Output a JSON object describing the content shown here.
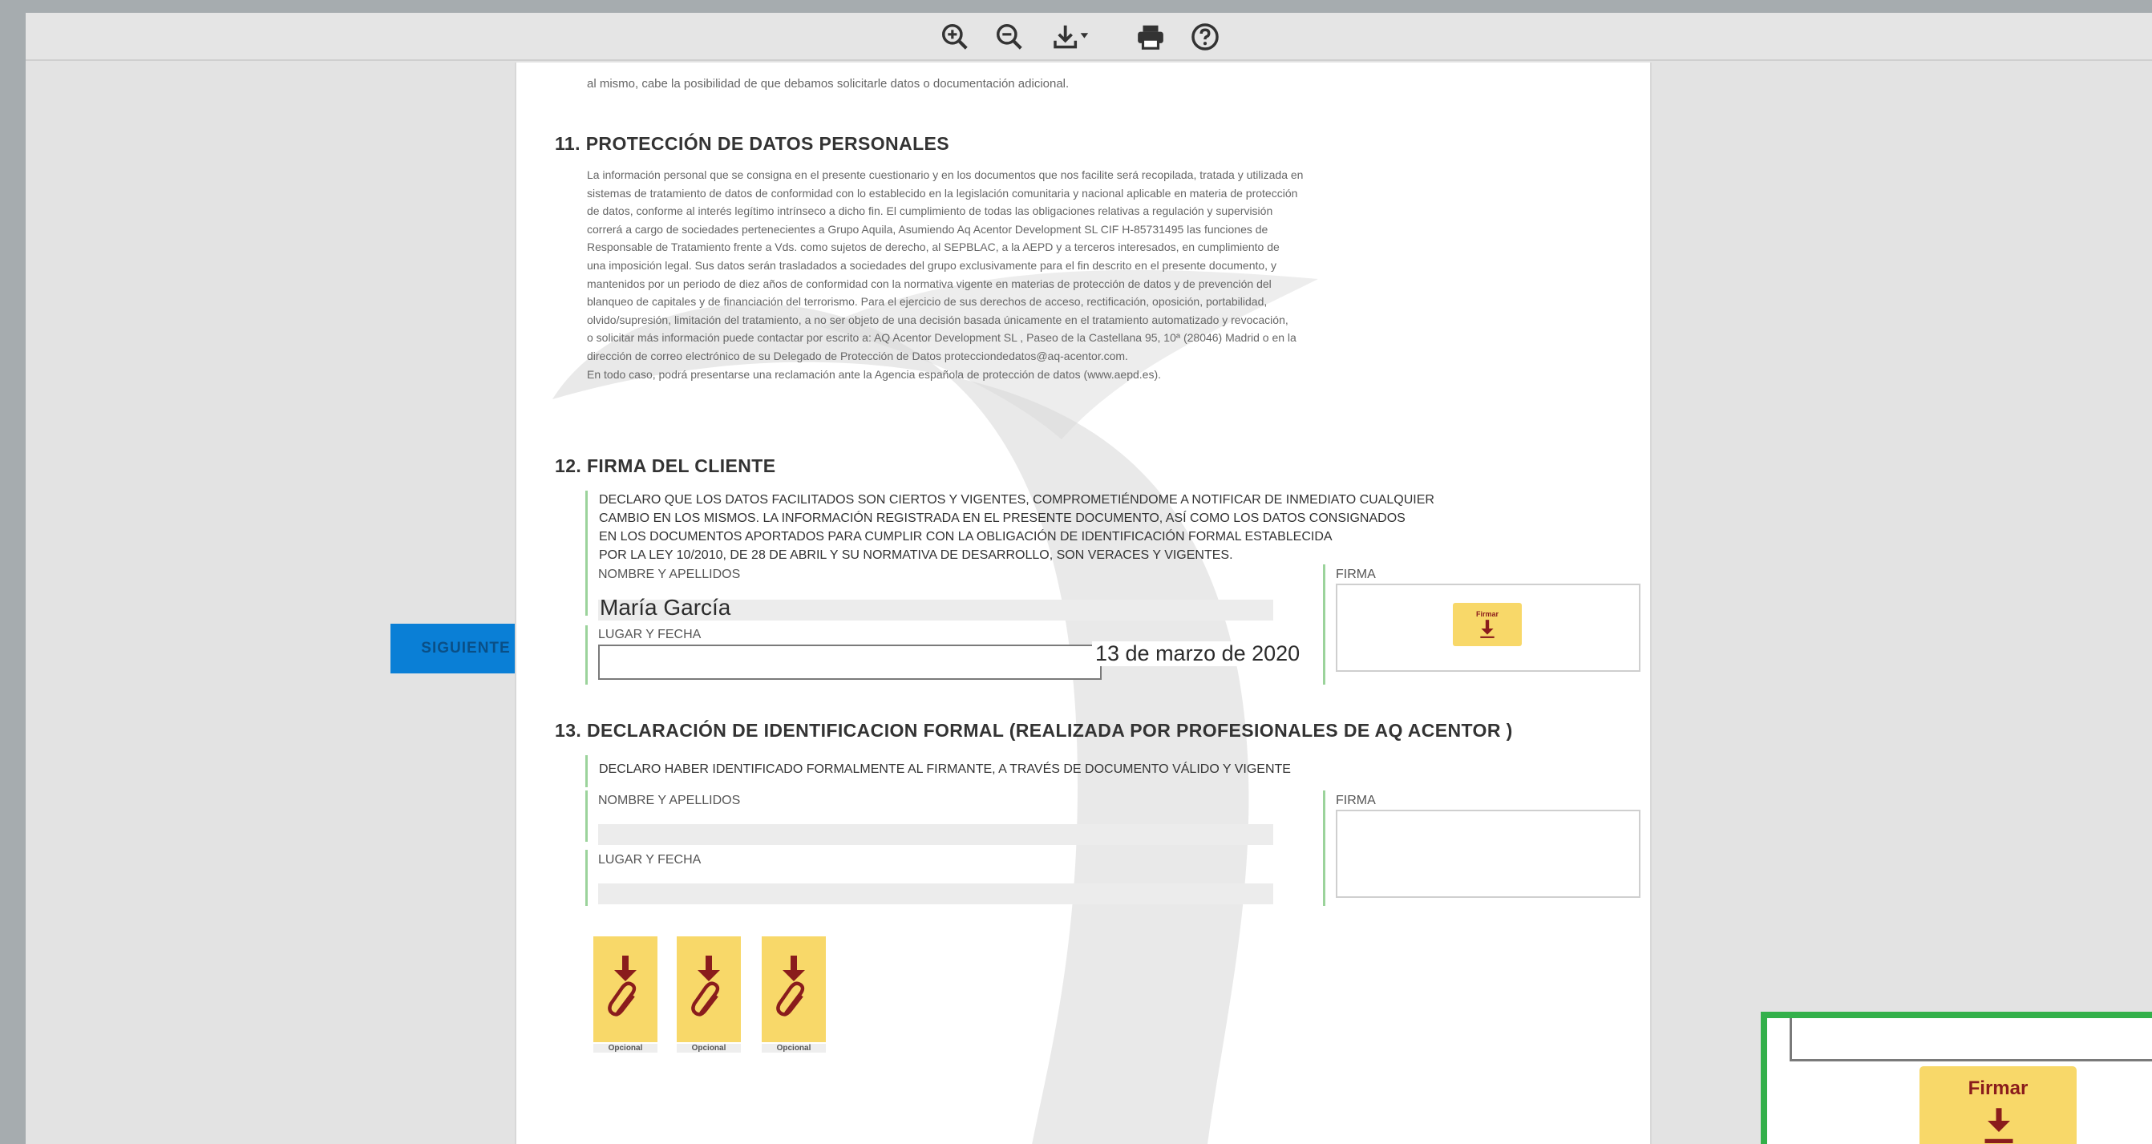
{
  "toolbar": {
    "buttons": [
      {
        "name": "zoom-in",
        "icon": "zoom-in-icon"
      },
      {
        "name": "zoom-out",
        "icon": "zoom-out-icon"
      },
      {
        "name": "download",
        "icon": "download-icon"
      },
      {
        "name": "print",
        "icon": "print-icon"
      },
      {
        "name": "help",
        "icon": "help-icon"
      }
    ]
  },
  "document": {
    "intro_text": "al mismo, cabe la posibilidad de que debamos solicitarle datos o documentación adicional.",
    "section11": {
      "heading": "11. PROTECCIÓN DE DATOS PERSONALES",
      "body": [
        "La información personal que se consigna en el presente cuestionario y en los documentos que nos facilite será recopilada, tratada y utilizada en",
        "sistemas de tratamiento de datos de conformidad con lo establecido en la legislación comunitaria y nacional aplicable en materia de protección",
        "de datos, conforme al interés legítimo intrínseco a dicho fin. El cumplimiento de todas las obligaciones relativas a regulación y supervisión",
        "correrá a cargo de sociedades pertenecientes a Grupo Aquila, Asumiendo Aq Acentor Development SL CIF H-85731495 las funciones de",
        "Responsable de Tratamiento frente a Vds. como sujetos de derecho, al SEPBLAC, a la AEPD y a terceros interesados, en cumplimiento de",
        "una imposición legal. Sus datos serán trasladados a sociedades del grupo exclusivamente para el fin descrito en el presente documento, y",
        "mantenidos por un periodo de diez años de conformidad con la normativa vigente en materias de protección de datos y de prevención del",
        "blanqueo de capitales y de financiación del terrorismo. Para el ejercicio de sus derechos de acceso, rectificación, oposición, portabilidad,",
        "olvido/supresión, limitación del tratamiento, a no ser objeto de una decisión basada únicamente en el tratamiento automatizado y revocación,",
        "o solicitar más información puede contactar por escrito a: AQ Acentor Development SL , Paseo de la Castellana 95, 10ª (28046) Madrid o en la",
        "dirección de correo electrónico de su Delegado de Protección de Datos protecciondedatos@aq-acentor.com.",
        "En todo caso, podrá presentarse una reclamación ante la Agencia española de protección de datos (www.aepd.es)."
      ]
    },
    "section12": {
      "heading": "12. FIRMA DEL CLIENTE",
      "declaration": [
        "DECLARO QUE LOS DATOS FACILITADOS SON CIERTOS Y VIGENTES, COMPROMETIÉNDOME A NOTIFICAR DE INMEDIATO CUALQUIER",
        "CAMBIO EN LOS MISMOS.  LA INFORMACIÓN REGISTRADA EN EL PRESENTE DOCUMENTO, ASÍ COMO LOS DATOS CONSIGNADOS",
        "EN LOS DOCUMENTOS APORTADOS PARA CUMPLIR CON LA OBLIGACIÓN DE IDENTIFICACIÓN FORMAL ESTABLECIDA",
        "POR LA LEY 10/2010, DE 28 DE ABRIL Y SU NORMATIVA DE DESARROLLO, SON VERACES Y VIGENTES."
      ],
      "name_label": "NOMBRE Y APELLIDOS",
      "name_value": "María García",
      "place_date_label": "LUGAR Y FECHA",
      "place_date_value": "13 de marzo de 2020",
      "signature_label": "FIRMA",
      "sign_button_label": "Firmar"
    },
    "section13": {
      "heading": "13. DECLARACIÓN DE IDENTIFICACION FORMAL (REALIZADA POR PROFESIONALES DE AQ ACENTOR )",
      "declaration": "DECLARO HABER IDENTIFICADO FORMALMENTE AL FIRMANTE, A TRAVÉS DE DOCUMENTO VÁLIDO Y VIGENTE",
      "name_label": "NOMBRE Y APELLIDOS",
      "place_date_label": "LUGAR Y FECHA",
      "signature_label": "FIRMA"
    },
    "attachments": [
      {
        "label": "Opcional"
      },
      {
        "label": "Opcional"
      },
      {
        "label": "Opcional"
      }
    ]
  },
  "next_button_label": "SIGUIENTE",
  "zoom_callout": {
    "sign_button_label": "Firmar"
  },
  "colors": {
    "accent_yellow": "#f8d869",
    "arrow_red": "#8a1c1c",
    "next_blue": "#0a7fd6",
    "highlight_green": "#33b04a",
    "section_bar_green": "#9bd39b"
  }
}
